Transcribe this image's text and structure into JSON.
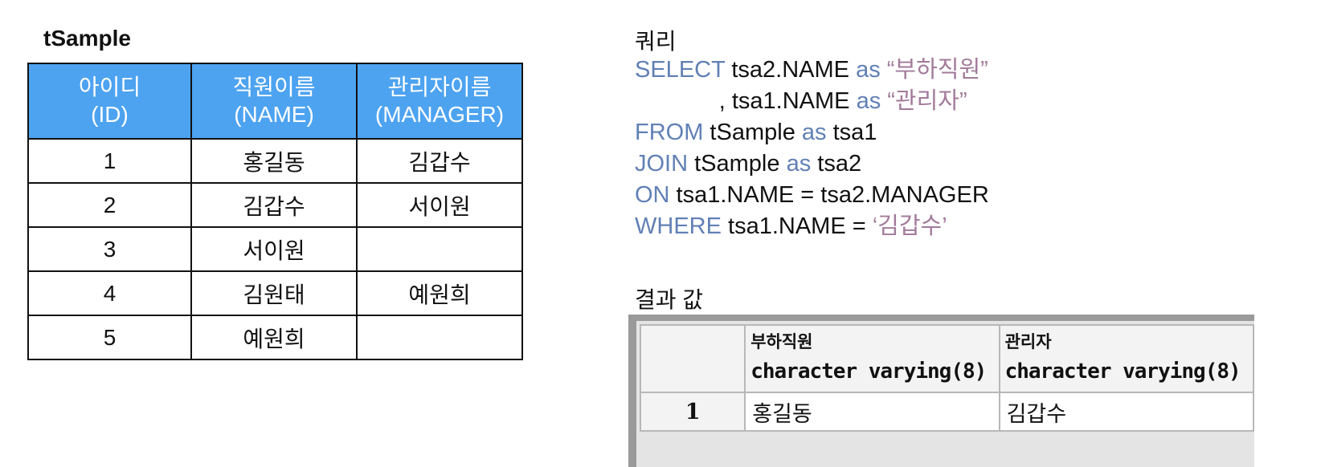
{
  "sample_table": {
    "title": "tSample",
    "headers": [
      {
        "line1": "아이디",
        "line2": "(ID)"
      },
      {
        "line1": "직원이름",
        "line2": "(NAME)"
      },
      {
        "line1": "관리자이름",
        "line2": "(MANAGER)"
      }
    ],
    "rows": [
      {
        "id": "1",
        "name": "홍길동",
        "manager": "김갑수"
      },
      {
        "id": "2",
        "name": "김갑수",
        "manager": "서이원"
      },
      {
        "id": "3",
        "name": "서이원",
        "manager": ""
      },
      {
        "id": "4",
        "name": "김원태",
        "manager": "예원희"
      },
      {
        "id": "5",
        "name": "예원희",
        "manager": ""
      }
    ]
  },
  "query": {
    "label": "쿼리",
    "lines": [
      {
        "kw": "SELECT",
        "text": " tsa2.NAME ",
        "kw2": "as",
        "str": " “부하직원”",
        "indent": ""
      },
      {
        "kw": "",
        "text": ", tsa1.NAME ",
        "kw2": "as",
        "str": " “관리자”",
        "indent": "             "
      },
      {
        "kw": "FROM",
        "text": " tSample ",
        "kw2": "as",
        "str": "",
        "tail": " tsa1",
        "indent": ""
      },
      {
        "kw": "JOIN",
        "text": " tSample ",
        "kw2": "as",
        "str": "",
        "tail": " tsa2",
        "indent": ""
      },
      {
        "kw": "ON",
        "text": " tsa1.NAME = tsa2.MANAGER",
        "kw2": "",
        "str": "",
        "indent": ""
      },
      {
        "kw": "WHERE",
        "text": " tsa1.NAME = ",
        "kw2": "",
        "str": "‘김갑수’",
        "indent": ""
      }
    ]
  },
  "result": {
    "label": "결과 값",
    "columns": [
      {
        "name": "부하직원",
        "type": "character varying(8)"
      },
      {
        "name": "관리자",
        "type": "character varying(8)"
      }
    ],
    "rows": [
      {
        "rownum": "1",
        "values": [
          "홍길동",
          "김갑수"
        ]
      }
    ]
  },
  "colors": {
    "header_bg": "#4da3f0",
    "keyword": "#6180b5",
    "string_literal": "#a27a9a"
  }
}
